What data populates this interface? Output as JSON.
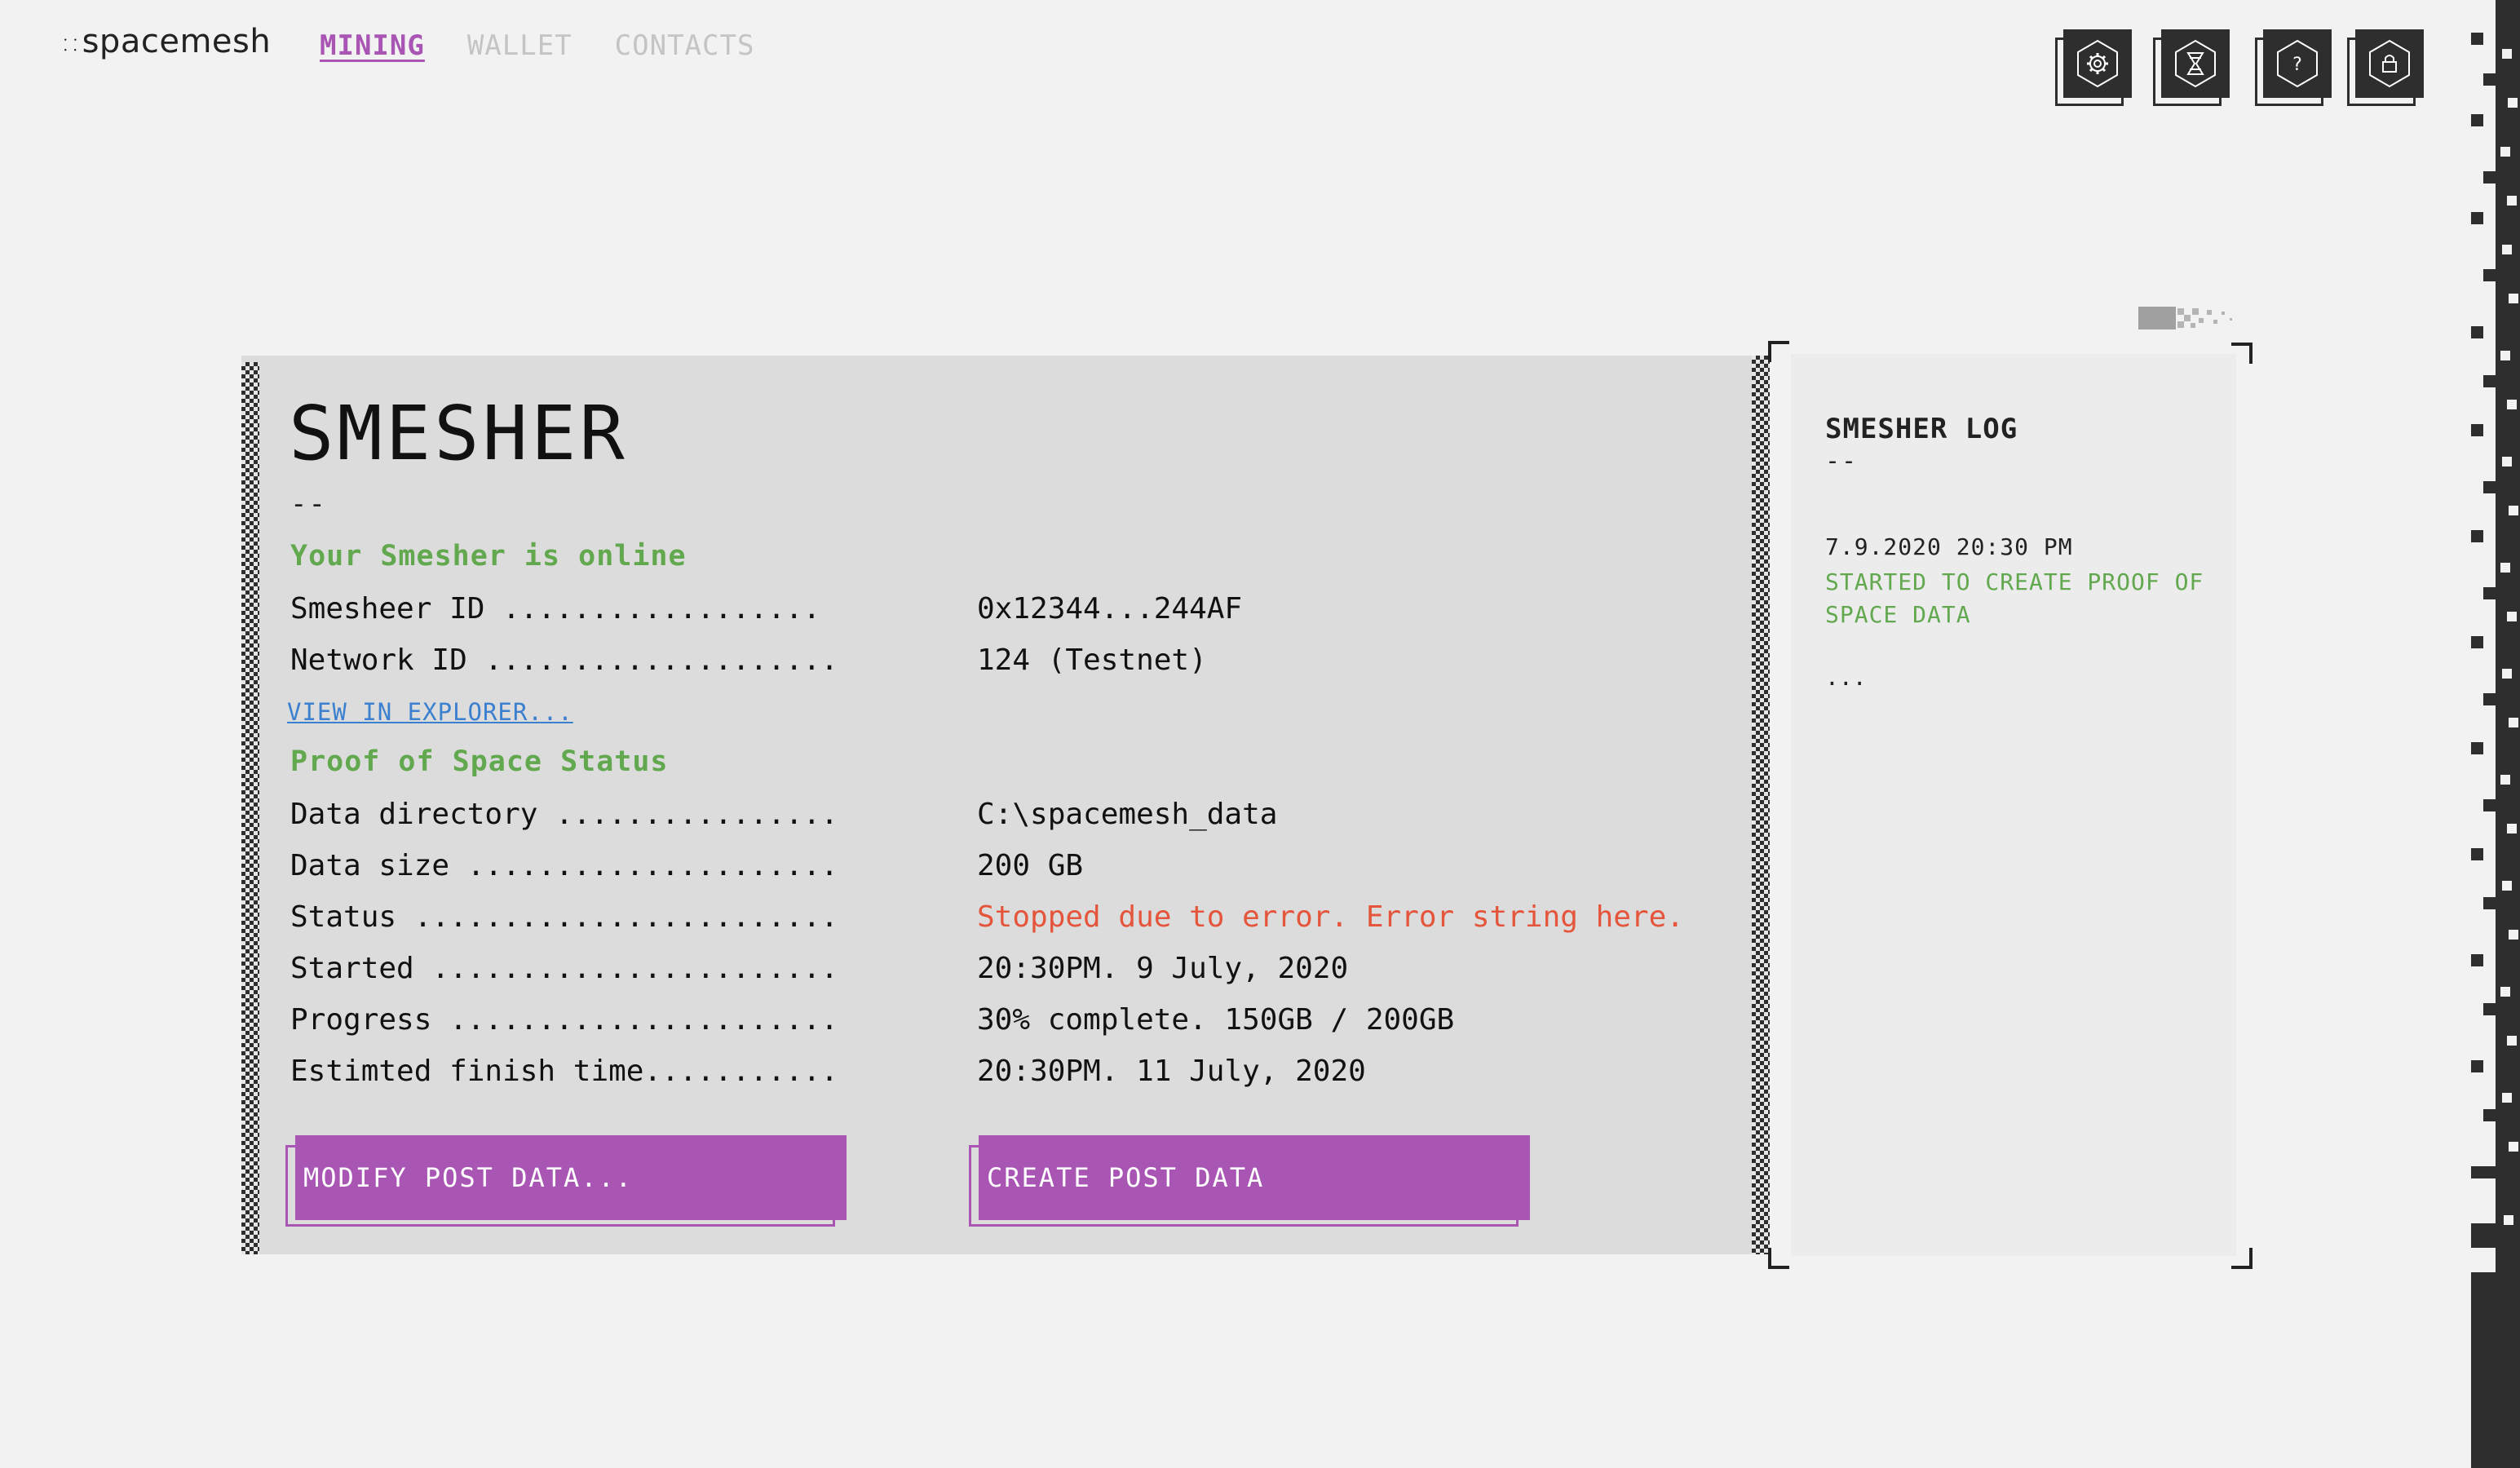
{
  "app": {
    "logo_mark": "⸬",
    "logo_text": "spacemesh"
  },
  "nav": {
    "items": [
      {
        "label": "MINING",
        "active": true
      },
      {
        "label": "WALLET",
        "active": false
      },
      {
        "label": "CONTACTS",
        "active": false
      }
    ]
  },
  "toolbar": {
    "icons": [
      "settings-icon",
      "network-icon",
      "help-icon",
      "lock-icon"
    ]
  },
  "smesher": {
    "title": "SMESHER",
    "divider": "--",
    "online_status": "Your Smesher is online",
    "id_rows": [
      {
        "label": "Smesheer ID ..................",
        "value": "0x12344...244AF"
      },
      {
        "label": "Network ID ....................",
        "value": "124 (Testnet)"
      }
    ],
    "explorer_link": "VIEW IN EXPLORER...",
    "post_heading": "Proof of Space Status",
    "post_rows": [
      {
        "label": "Data directory ................",
        "value": "C:\\spacemesh_data"
      },
      {
        "label": "Data size .....................",
        "value": "200 GB"
      },
      {
        "label": "Status ........................",
        "value": "Stopped due to error. Error string here.",
        "error": true
      },
      {
        "label": "Started .......................",
        "value": "20:30PM. 9 July, 2020"
      },
      {
        "label": "Progress ......................",
        "value": "30% complete. 150GB / 200GB"
      },
      {
        "label": "Estimted finish time...........",
        "value": "20:30PM. 11 July, 2020"
      }
    ],
    "modify_button": "MODIFY POST DATA...",
    "create_button": "CREATE POST DATA"
  },
  "log": {
    "title": "SMESHER LOG",
    "divider": "--",
    "entries": [
      {
        "date": "7.9.2020 20:30 PM",
        "message": "STARTED TO CREATE PROOF OF SPACE DATA"
      }
    ],
    "more": "..."
  },
  "colors": {
    "accent": "#a855b4",
    "online_green": "#62a84e",
    "error_red": "#e4553b",
    "link_blue": "#3b7fcf",
    "dark": "#2e2e2e"
  }
}
